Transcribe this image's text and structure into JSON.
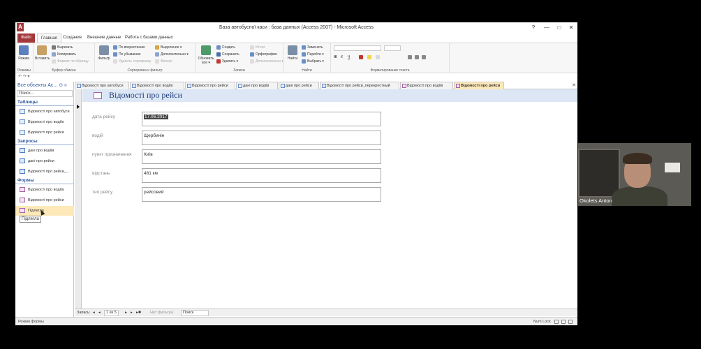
{
  "window": {
    "title": "База автобусної каси : база данных (Access 2007) - Microsoft Access",
    "app_logo": "A",
    "qat": "↶ ↷ ▾",
    "minimize": "—",
    "maximize": "□",
    "close": "✕",
    "help": "?"
  },
  "ribbon_tabs": [
    "Файл",
    "Главная",
    "Создание",
    "Внешние данные",
    "Работа с базами данных"
  ],
  "ribbon": {
    "views": {
      "label": "Режимы",
      "btn": "Режим"
    },
    "clipboard": {
      "label": "Буфер обмена",
      "paste": "Вставить",
      "cut": "Вырезать",
      "copy": "Копировать",
      "format": "Формат по образцу"
    },
    "sort": {
      "label": "Сортировка и фильтр",
      "filter": "Фильтр",
      "asc": "По возрастанию",
      "desc": "По убыванию",
      "remove": "Удалить сортировку",
      "selection": "Выделение ▾",
      "advanced": "Дополнительно ▾",
      "toggle": "Фильтр"
    },
    "records": {
      "label": "Записи",
      "refresh": "Обновить все ▾",
      "new": "Создать",
      "save": "Сохранить",
      "delete": "Удалить ▾",
      "totals": "Итоги",
      "spelling": "Орфография",
      "more": "Дополнительно ▾"
    },
    "find": {
      "label": "Найти",
      "find": "Найти",
      "replace": "Заменить",
      "goto": "Перейти ▾",
      "select": "Выбрать ▾"
    },
    "text": {
      "label": "Форматирование текста",
      "b": "Ж",
      "i": "К",
      "u": "Ч"
    }
  },
  "nav": {
    "header": "Все объекты Ac... ⊙ «",
    "search_placeholder": "Поиск...",
    "sections": {
      "tables": "Таблицы",
      "queries": "Запросы",
      "forms": "Формы"
    },
    "tables": [
      "Відомості про автобуси",
      "Відомості про водіїв",
      "Відомості про рейси"
    ],
    "queries": [
      "дані про водіїв",
      "дані про рейси",
      "Відомості про рейси_..."
    ],
    "forms": [
      "Відомості про водіїв",
      "Відомості про рейси",
      "Підлеглa"
    ],
    "tooltip": "Підлегла"
  },
  "doc_tabs": [
    "Відомості про автобуси",
    "Відомості про водіїв",
    "Відомості про рейси",
    "дані про водіїв",
    "дані про рейси",
    "Відомості про рейси_перекрестный",
    "Відомості про водіїв",
    "Відомості про рейси"
  ],
  "form": {
    "title": "Відомості про рейси",
    "fields": [
      {
        "label": "дата рейсу",
        "value": "17.06.2017"
      },
      {
        "label": "водій",
        "value": "Щербинін"
      },
      {
        "label": "пункт призначення",
        "value": "Київ"
      },
      {
        "label": "відстань",
        "value": "481 км"
      },
      {
        "label": "тип рейсу",
        "value": "рейсовий"
      }
    ]
  },
  "record_nav": {
    "label": "Запись:",
    "first": "◂",
    "prev": "◂",
    "position": "1 из 5",
    "next": "▸",
    "last": "▸",
    "new": "▸✱",
    "filter": "Нет фильтра",
    "search": "Поиск"
  },
  "status": {
    "left": "Режим формы",
    "numlock": "Num Lock"
  },
  "webcam": {
    "name": "Okolets Anton"
  }
}
